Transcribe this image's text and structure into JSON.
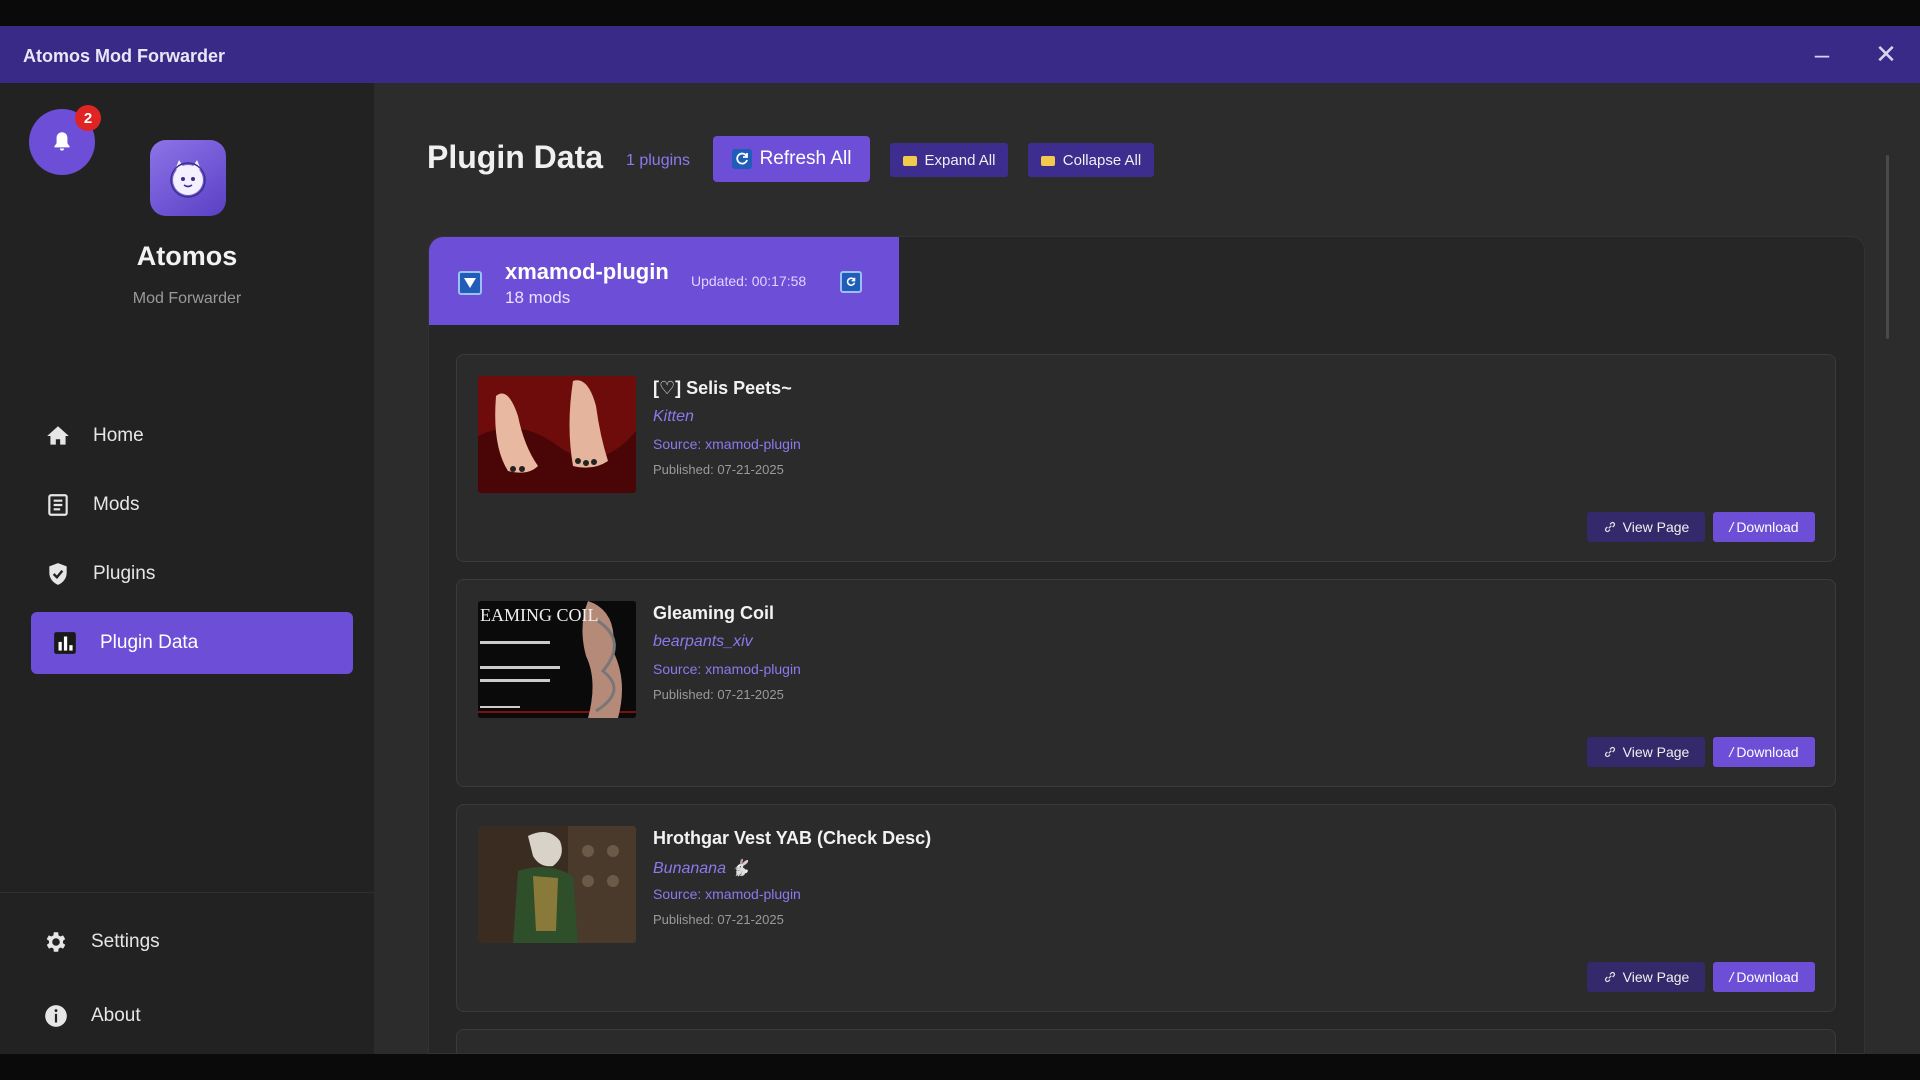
{
  "window": {
    "title": "Atomos Mod Forwarder",
    "minimize_glyph": "–",
    "close_glyph": "✕"
  },
  "sidebar": {
    "notification_count": "2",
    "app_name": "Atomos",
    "app_subtitle": "Mod Forwarder",
    "nav": [
      {
        "label": "Home",
        "icon": "home-icon"
      },
      {
        "label": "Mods",
        "icon": "document-icon"
      },
      {
        "label": "Plugins",
        "icon": "shield-check-icon"
      },
      {
        "label": "Plugin Data",
        "icon": "bar-chart-icon"
      }
    ],
    "bottom_nav": [
      {
        "label": "Settings",
        "icon": "gear-icon"
      },
      {
        "label": "About",
        "icon": "info-icon"
      }
    ]
  },
  "main": {
    "title": "Plugin Data",
    "plugin_count": "1 plugins",
    "refresh_all_label": "Refresh All",
    "expand_all_label": "Expand All",
    "collapse_all_label": "Collapse All",
    "plugin": {
      "name": "xmamod-plugin",
      "mod_count": "18 mods",
      "updated": "Updated: 00:17:58"
    },
    "mods": [
      {
        "title": "[♡] Selis Peets~",
        "author": "Kitten",
        "source": "Source: xmamod-plugin",
        "published": "Published: 07-21-2025",
        "view_label": "View Page",
        "download_label": "Download"
      },
      {
        "title": "Gleaming Coil",
        "author": "bearpants_xiv",
        "source": "Source: xmamod-plugin",
        "published": "Published: 07-21-2025",
        "view_label": "View Page",
        "download_label": "Download",
        "thumb_text": "EAMING COIL"
      },
      {
        "title": "Hrothgar Vest YAB (Check Desc)",
        "author": "Bunanana 🐇",
        "source": "Source: xmamod-plugin",
        "published": "Published: 07-21-2025",
        "view_label": "View Page",
        "download_label": "Download"
      }
    ]
  },
  "colors": {
    "accent": "#6c4fd6",
    "titlebar": "#382a86",
    "link": "#8f78ee"
  }
}
